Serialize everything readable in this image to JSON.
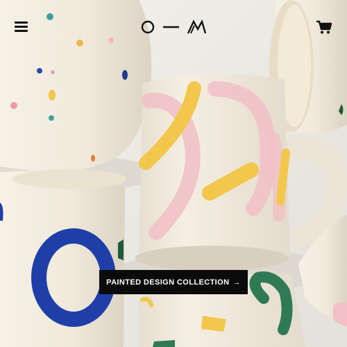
{
  "header": {
    "menu_icon": "hamburger-menu-icon",
    "logo_icon": "o-m-logo-icon",
    "cart_icon": "shopping-cart-icon"
  },
  "hero": {
    "image_subject": "painted ceramic mugs",
    "cta_label": "PAINTED DESIGN COLLECTION",
    "cta_arrow": "→"
  },
  "colors": {
    "cta_background": "#0b0b0b",
    "cta_text": "#ffffff",
    "icon": "#111111"
  }
}
